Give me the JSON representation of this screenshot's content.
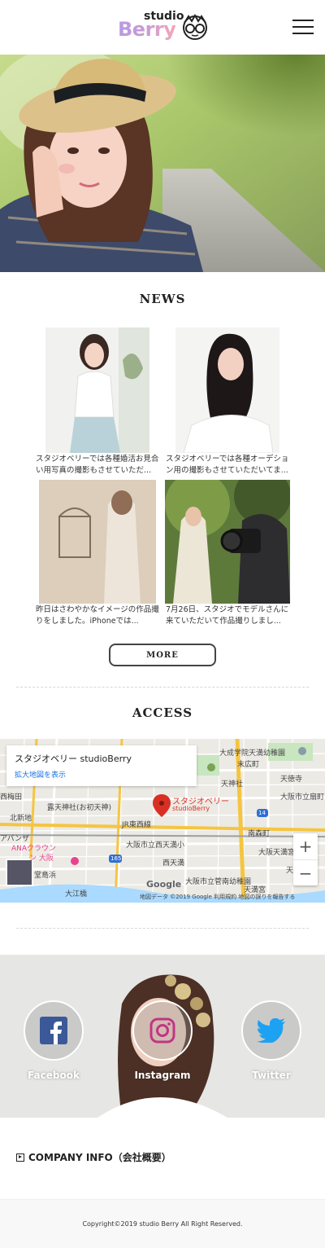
{
  "header": {
    "logo_studio": "studio",
    "logo_berry": "Berry"
  },
  "news": {
    "title": "NEWS",
    "items": [
      {
        "text": "スタジオベリーでは各種婚活お見合い用写真の撮影もさせていただ..."
      },
      {
        "text": "スタジオベリーでは各種オーデション用の撮影もさせていただいてま..."
      },
      {
        "text": "昨日はさわやかなイメージの作品撮りをしました。iPhoneでは..."
      },
      {
        "text": "7月26日、スタジオでモデルさんに来ていただいて作品撮りしまし..."
      }
    ],
    "more_label": "MORE"
  },
  "access": {
    "title": "ACCESS",
    "map": {
      "place_title": "スタジオベリー studioBerry",
      "enlarge_link": "拡大地図を表示",
      "pin_label_1": "スタジオベリー",
      "pin_label_2": "studioBerry",
      "labels": {
        "shrine": "露天神社(お初天神)",
        "jr": "JR東西線",
        "nishitemma": "大阪市立西天満小",
        "nishitenma": "西天満",
        "sugaminami": "大阪市立菅南幼稚園",
        "kitashinchi": "北新地",
        "nishiumeda": "西梅田",
        "tenma_jinja": "大阪天満宮",
        "tenmagu": "天満宮",
        "minamimorimachi": "南森町",
        "tenjin": "天神社",
        "tenjin_school": "大成学院天満幼稚園",
        "tenjin_pref": "天徳寺",
        "osaka_kindergarten": "大阪市立扇町",
        "ana": "ANAクラウン",
        "osaka": "ン 大阪",
        "apaza": "アバンザ",
        "dojima": "堂島浜",
        "oebashi": "大江橋",
        "route_165": "165",
        "route_14": "14",
        "tenjin2": "天神橋",
        "matsu": "末広町"
      },
      "google": "Google",
      "footer": "地図データ ©2019 Google   利用規約   地図の誤りを報告する",
      "zoom_in": "+",
      "zoom_out": "−"
    }
  },
  "social": {
    "facebook": "Facebook",
    "instagram": "Instagram",
    "twitter": "Twitter"
  },
  "company": {
    "label": "COMPANY INFO（会社概要）"
  },
  "footer": {
    "copyright": "Copyright©2019 studio Berry All Right Reserved."
  },
  "colors": {
    "facebook": "#3b5998",
    "instagram": "#c13584",
    "twitter": "#1da1f2",
    "map_pin": "#d93025"
  }
}
